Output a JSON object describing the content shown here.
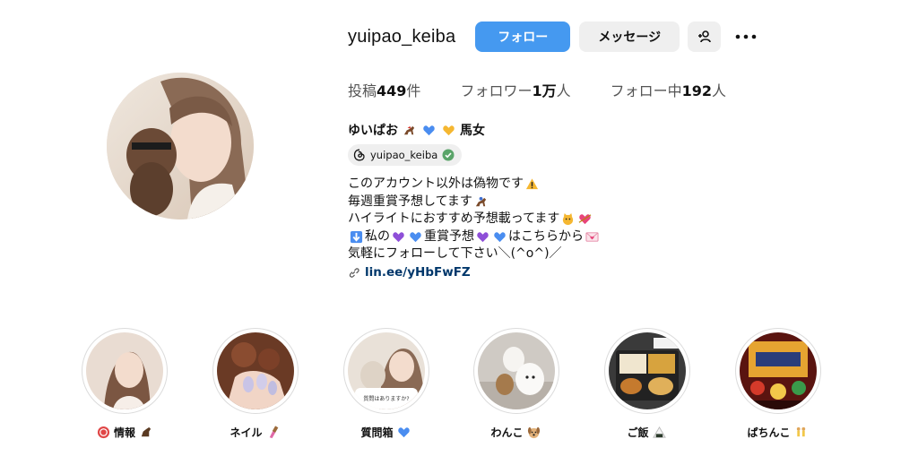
{
  "profile": {
    "username": "yuipao_keiba",
    "follow_label": "フォロー",
    "message_label": "メッセージ",
    "stats": {
      "posts_prefix": "投稿",
      "posts_value": "449",
      "posts_suffix": "件",
      "followers_prefix": "フォロワー",
      "followers_value": "1万",
      "followers_suffix": "人",
      "following_prefix": "フォロー中",
      "following_value": "192",
      "following_suffix": "人"
    },
    "display_name_a": "ゆいぱお",
    "display_name_b": "馬女",
    "threads_handle": "yuipao_keiba",
    "bio": {
      "line1": "このアカウント以外は偽物です",
      "line2": "毎週重賞予想してます",
      "line3": "ハイライトにおすすめ予想載ってます",
      "line4a": "私の",
      "line4b": "重賞予想",
      "line4c": "はこちらから",
      "line5": "気軽にフォローして下さい＼(^o^)／"
    },
    "link": "lin.ee/yHbFwFZ"
  },
  "highlights": [
    {
      "label": "情報"
    },
    {
      "label": "ネイル"
    },
    {
      "label": "質問箱"
    },
    {
      "label": "わんこ"
    },
    {
      "label": "ご飯"
    },
    {
      "label": "ぱちんこ"
    }
  ],
  "question_card_text": "質問はありますか?",
  "colors": {
    "accent": "#4599f0",
    "button_gray": "#efefef",
    "link": "#00376b",
    "verified": "#5aa469"
  },
  "icons": [
    "add-user-icon",
    "more-icon",
    "threads-icon",
    "verified-icon",
    "link-icon",
    "horse-emoji",
    "blue-heart-emoji",
    "yellow-heart-emoji",
    "purple-heart-emoji",
    "warning-emoji",
    "down-arrow-emoji",
    "love-letter-emoji"
  ]
}
